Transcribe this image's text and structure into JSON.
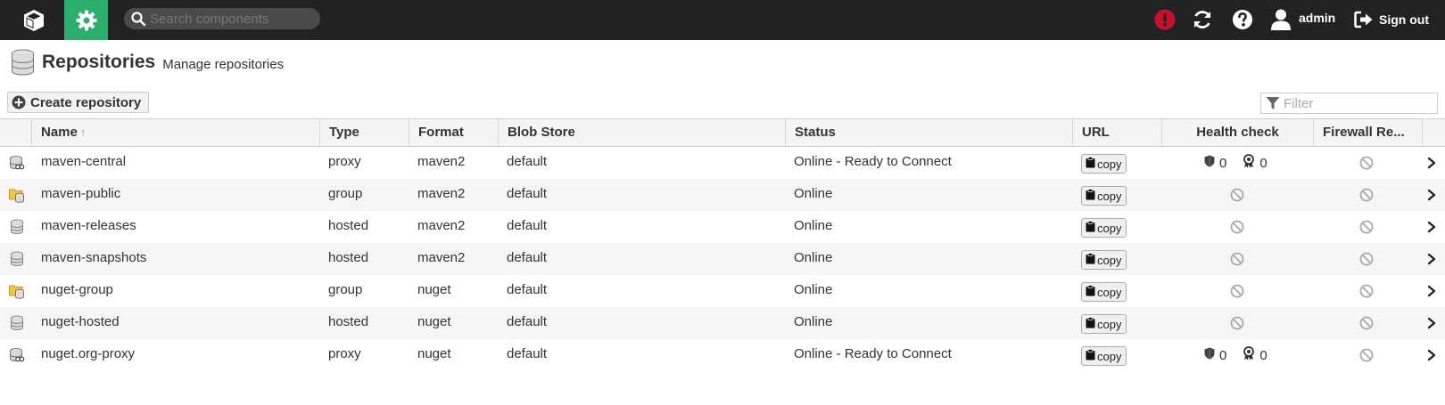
{
  "topbar": {
    "logo_icon": "cube-icon",
    "admin_icon": "gear-icon",
    "search": {
      "placeholder": "Search components",
      "value": ""
    },
    "alert_icon": "exclamation-circle-icon",
    "alert_color": "#c8102e",
    "refresh_icon": "refresh-icon",
    "help_icon": "question-circle-icon",
    "user_icon": "user-icon",
    "username": "admin",
    "signout_icon": "sign-out-icon",
    "signout_label": "Sign out"
  },
  "page": {
    "icon": "database-icon",
    "title": "Repositories",
    "subtitle": "Manage repositories"
  },
  "toolbar": {
    "create_icon": "plus-circle-icon",
    "create_label": "Create repository",
    "filter_icon": "filter-icon",
    "filter_placeholder": "Filter",
    "filter_value": ""
  },
  "table": {
    "columns": {
      "name": "Name",
      "name_sort": "↑",
      "type": "Type",
      "format": "Format",
      "blob_store": "Blob Store",
      "status": "Status",
      "url": "URL",
      "health_check": "Health check",
      "firewall": "Firewall Re..."
    },
    "copy_label": "copy",
    "rows": [
      {
        "icon": "proxy-repo-icon",
        "name": "maven-central",
        "type": "proxy",
        "format": "maven2",
        "blob_store": "default",
        "status": "Online - Ready to Connect",
        "health": {
          "security": "0",
          "license": "0"
        }
      },
      {
        "icon": "group-repo-icon",
        "name": "maven-public",
        "type": "group",
        "format": "maven2",
        "blob_store": "default",
        "status": "Online",
        "health": null
      },
      {
        "icon": "hosted-repo-icon",
        "name": "maven-releases",
        "type": "hosted",
        "format": "maven2",
        "blob_store": "default",
        "status": "Online",
        "health": null
      },
      {
        "icon": "hosted-repo-icon",
        "name": "maven-snapshots",
        "type": "hosted",
        "format": "maven2",
        "blob_store": "default",
        "status": "Online",
        "health": null
      },
      {
        "icon": "group-repo-icon",
        "name": "nuget-group",
        "type": "group",
        "format": "nuget",
        "blob_store": "default",
        "status": "Online",
        "health": null
      },
      {
        "icon": "hosted-repo-icon",
        "name": "nuget-hosted",
        "type": "hosted",
        "format": "nuget",
        "blob_store": "default",
        "status": "Online",
        "health": null
      },
      {
        "icon": "proxy-repo-icon",
        "name": "nuget.org-proxy",
        "type": "proxy",
        "format": "nuget",
        "blob_store": "default",
        "status": "Online - Ready to Connect",
        "health": {
          "security": "0",
          "license": "0"
        }
      }
    ]
  },
  "colors": {
    "topbar_bg": "#222222",
    "accent_green": "#2eae6d",
    "alert_red": "#c8102e"
  }
}
